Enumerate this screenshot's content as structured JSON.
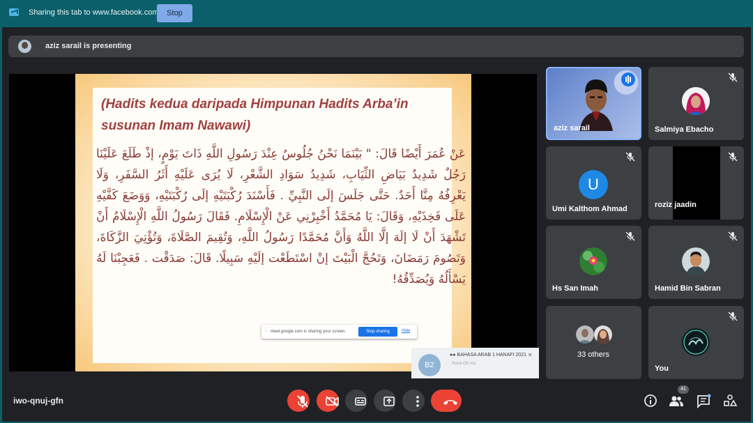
{
  "banner": {
    "text": "Sharing this tab to www.facebook.com",
    "stop_label": "Stop"
  },
  "presenting": {
    "label": "aziz sarail is presenting"
  },
  "slide": {
    "title": "(Hadits kedua daripada Himpunan Hadits Arba’in susunan Imam Nawawi)",
    "arabic": "عَنْ عُمَرَ أَيْضًا قَالَ: \" بَيْنَمَا نَحْنُ جُلُوسٌ عِنْدَ رَسُولِ اللَّهِ ذَاتَ يَوْمٍ، إذْ طَلَعَ عَلَيْنَا رَجُلٌ شَدِيدُ بَيَاضِ الثِّيَابِ، شَدِيدُ سَوَادِ الشَّعْرِ، لَا يُرَى عَلَيْهِ أَثَرُ السَّفَرِ، وَلَا يَعْرِفُهُ مِنَّا أَحَدٌ. حَتَّى جَلَسَ إلَى النَّبِيِّ . فَأَسْنَدَ رُكْبَتَيْهِ إلَى رُكْبَتَيْهِ، وَوَضَعَ كَفَّيْهِ عَلَى فَخِذَيْهِ، وَقَالَ: يَا مُحَمَّدُ أَخْبِرْنِي عَنْ الْإِسْلَامِ. فَقَالَ رَسُولُ اللَّهِ الْإِسْلَامُ أَنْ تَشْهَدَ أَنْ لَا إلَهَ إلَّا اللَّهُ وَأَنَّ مُحَمَّدًا رَسُولُ اللَّهِ، وَتُقِيمَ الصَّلَاةَ، وَتُؤْتِيَ الزَّكَاةَ، وَتَصُومَ رَمَضَانَ، وَتَحُجَّ الْبَيْتَ إنْ اسْتَطَعْت إلَيْهِ سَبِيلًا. قَالَ: صَدَقْت . فَعَجِبْنَا لَهُ يَسْأَلُهُ وَيُصَدِّقُهُ!",
    "share_popup": {
      "message": "meet.google.com is sharing your screen.",
      "stop_label": "Stop sharing",
      "hide_label": "Hide"
    }
  },
  "notification": {
    "badge": "B2",
    "title": "BAHASA ARAB 1 HANAFI 2021",
    "subtitle": "Nurul Oh sss"
  },
  "participants": [
    {
      "name": "aziz sarail",
      "speaking": true
    },
    {
      "name": "Salmiya Ebacho",
      "muted": true
    },
    {
      "name": "Umi Kalthom Ahmad",
      "initial": "U",
      "muted": true
    },
    {
      "name": "roziz jaadin",
      "muted": true
    },
    {
      "name": "Hs San Imah",
      "muted": true
    },
    {
      "name": "Hamid Bin Sabran",
      "muted": true
    },
    {
      "name": "33 others"
    },
    {
      "name": "You",
      "muted": true
    }
  ],
  "bottom": {
    "meeting_code": "iwo-qnuj-gfn",
    "people_count": "41"
  },
  "colors": {
    "banner_bg": "#0b5f6a",
    "meet_bg": "#202124",
    "tile_bg": "#3c4043",
    "danger": "#ea4335",
    "accent": "#1a73e8"
  }
}
